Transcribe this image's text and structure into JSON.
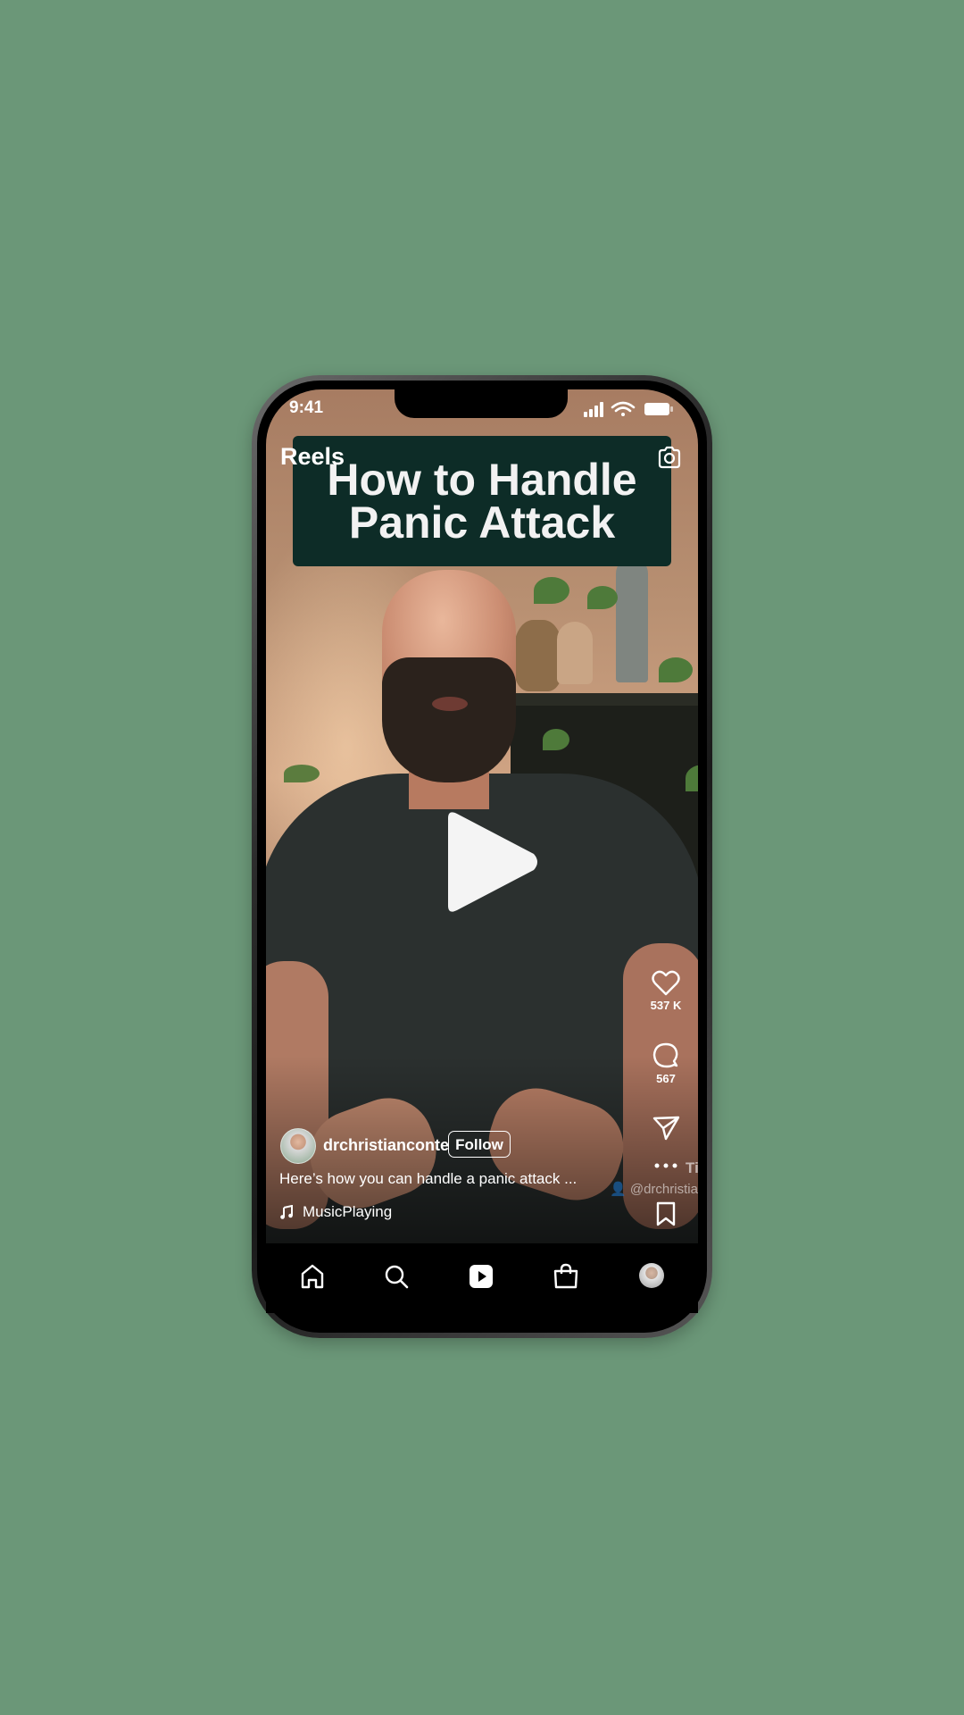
{
  "status_bar": {
    "time": "9:41"
  },
  "header": {
    "title": "Reels"
  },
  "video": {
    "overlay_title_line1": "How to Handle",
    "overlay_title_line2": "Panic Attack",
    "watermark": "@drchristia",
    "watermark_corner": "Ti"
  },
  "actions": {
    "likes": "537 K",
    "comments": "567"
  },
  "post": {
    "username": "drchristianconte",
    "follow_label": "Follow",
    "caption": "Here’s how you can handle a panic attack ...",
    "music": "MusicPlaying"
  },
  "icons": {
    "camera": "camera-icon",
    "play": "play-icon",
    "like": "heart-icon",
    "comment": "comment-icon",
    "share": "send-icon",
    "more": "more-icon",
    "save": "bookmark-icon",
    "home": "home-icon",
    "search": "search-icon",
    "reels": "reels-icon",
    "shop": "shop-icon"
  },
  "colors": {
    "background": "#6b9778",
    "title_box": "#0d2c27",
    "text": "#ffffff"
  }
}
